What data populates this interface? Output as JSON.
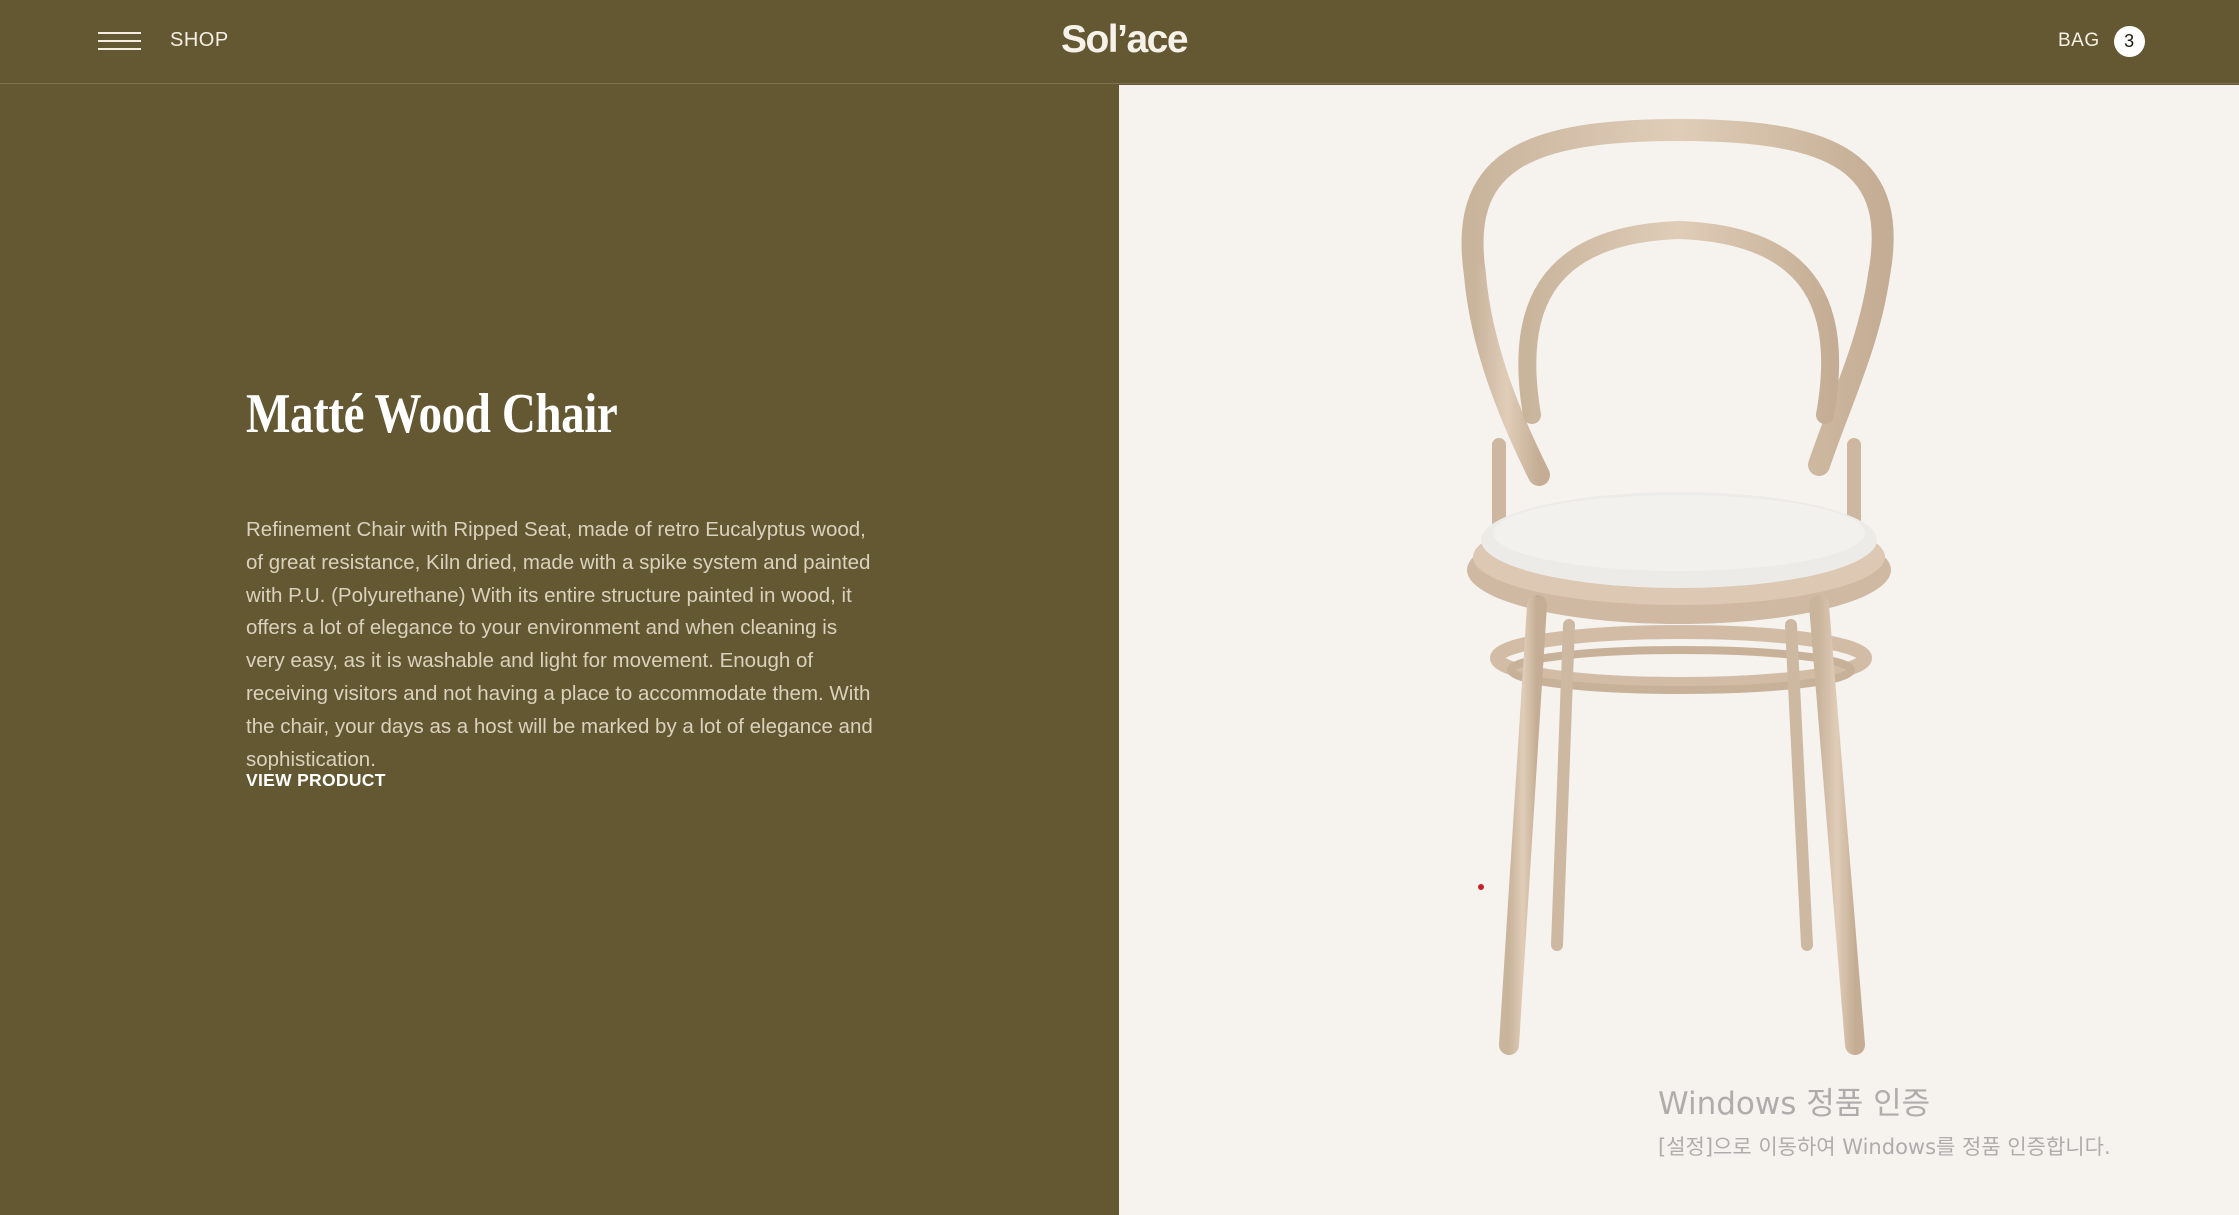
{
  "header": {
    "shop_label": "SHOP",
    "logo_text": "Sol’ace",
    "bag_label": "BAG",
    "bag_count": "3"
  },
  "product": {
    "title": "Matté Wood Chair",
    "description": "Refinement Chair with Ripped Seat, made of retro Eucalyptus wood, of great resistance, Kiln dried, made with a spike system and painted with P.U. (Polyurethane) With its entire structure painted in wood, it offers a lot of elegance to your environment and when cleaning is very easy, as it is washable and light for movement. Enough of receiving visitors and not having a place to accommodate them. With the chair, your days as a host will be marked by a lot of elegance and sophistication.",
    "cta_label": "VIEW PRODUCT"
  },
  "watermark": {
    "title": "Windows 정품 인증",
    "subtitle": "[설정]으로 이동하여 Windows를 정품 인증합니다."
  },
  "colors": {
    "brand_bg": "#645832",
    "image_bg": "#f6f3ef",
    "wood": "#d9c4ae",
    "seat": "#ecebe8"
  },
  "icons": {
    "menu": "hamburger-menu-icon"
  }
}
